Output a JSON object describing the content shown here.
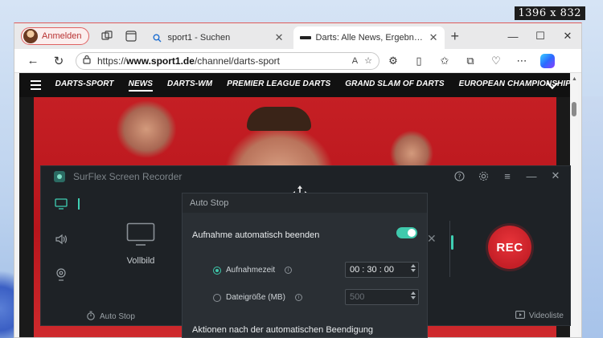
{
  "screen_badge": "1396 x 832",
  "browser": {
    "profile_label": "Anmelden",
    "tabs": [
      {
        "title": "sport1 - Suchen",
        "active": false
      },
      {
        "title": "Darts: Alle News, Ergebnisse & Infos",
        "active": true
      }
    ],
    "url_prefix": "https://",
    "url_domain": "www.sport1.de",
    "url_path": "/channel/darts-sport",
    "reader_label": "A"
  },
  "site": {
    "nav_items": [
      {
        "label": "DARTS-SPORT",
        "active": false
      },
      {
        "label": "NEWS",
        "active": true
      },
      {
        "label": "DARTS-WM",
        "active": false
      },
      {
        "label": "PREMIER LEAGUE DARTS",
        "active": false
      },
      {
        "label": "GRAND SLAM OF DARTS",
        "active": false
      },
      {
        "label": "EUROPEAN CHAMPIONSHIP",
        "active": false
      }
    ]
  },
  "recorder": {
    "app_name": "SurFlex Screen Recorder",
    "mode_label": "Vollbild",
    "autostop_label": "Auto Stop",
    "videolist_label": "Videoliste",
    "rec_label": "REC"
  },
  "autostop_dialog": {
    "title": "Auto Stop",
    "toggle_label": "Aufnahme automatisch beenden",
    "toggle_on": true,
    "time_option_label": "Aufnahmezeit",
    "time_value": "00 : 30 : 00",
    "size_option_label": "Dateigröße (MB)",
    "size_value": "500",
    "after_label": "Aktionen nach der automatischen Beendigung"
  },
  "colors": {
    "accent_teal": "#3fc9ac",
    "rec_red": "#c51f27",
    "sport_red": "#c51f24"
  }
}
